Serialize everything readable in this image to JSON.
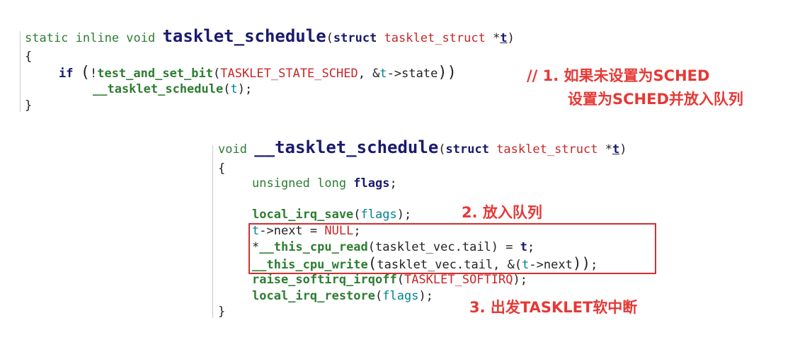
{
  "code1": {
    "l1": {
      "a": "static inline void ",
      "fn": "tasklet_schedule",
      "b": "(",
      "c": "struct ",
      "d": "tasklet_struct ",
      "e": "*",
      "f": "t",
      "g": ")"
    },
    "l2": "{",
    "l3": {
      "a": "if ",
      "b": "(",
      "c": "!",
      "d": "test_and_set_bit",
      "e": "(",
      "f": "TASKLET_STATE_SCHED",
      "g": ", &",
      "h": "t",
      "i": "->state",
      "j": "))"
    },
    "l4": {
      "a": "__tasklet_schedule",
      "b": "(",
      "c": "t",
      "d": ");"
    },
    "l5": "}"
  },
  "code2": {
    "l1": {
      "a": "void ",
      "fn": "__tasklet_schedule",
      "b": "(",
      "c": "struct ",
      "d": "tasklet_struct ",
      "e": "*",
      "f": "t",
      "g": ")"
    },
    "l2": "{",
    "l3": {
      "a": "unsigned long ",
      "b": "flags",
      "c": ";"
    },
    "l4": {
      "a": "local_irq_save",
      "b": "(",
      "c": "flags",
      "d": ");"
    },
    "l5": {
      "a": "t",
      "b": "->next = ",
      "c": "NULL",
      "d": ";"
    },
    "l6": {
      "a": "*",
      "b": "__this_cpu_read",
      "c": "(",
      "d": "tasklet_vec.tail",
      "e": ") = ",
      "f": "t",
      "g": ";"
    },
    "l7": {
      "a": "__this_cpu_write",
      "b": "(",
      "c": "tasklet_vec.tail, &",
      "d": "(",
      "e": "t",
      "f": "->next",
      "g": "))",
      "h": ";"
    },
    "l8": {
      "a": "raise_softirq_irqoff",
      "b": "(",
      "c": "TASKLET_SOFTIRQ",
      "d": ");"
    },
    "l9": {
      "a": "local_irq_restore",
      "b": "(",
      "c": "flags",
      "d": ");"
    },
    "l10": "}"
  },
  "notes": {
    "n1a": "// 1. 如果未设置为SCHED",
    "n1b": "设置为SCHED并放入队列",
    "n2": "2. 放入队列",
    "n3": "3. 出发TASKLET软中断"
  },
  "colors": {
    "annotation": "#e53935",
    "box": "#d32f2f",
    "keyword": "#2e7d32",
    "function": "#1a1a6e",
    "constant": "#c62828"
  }
}
